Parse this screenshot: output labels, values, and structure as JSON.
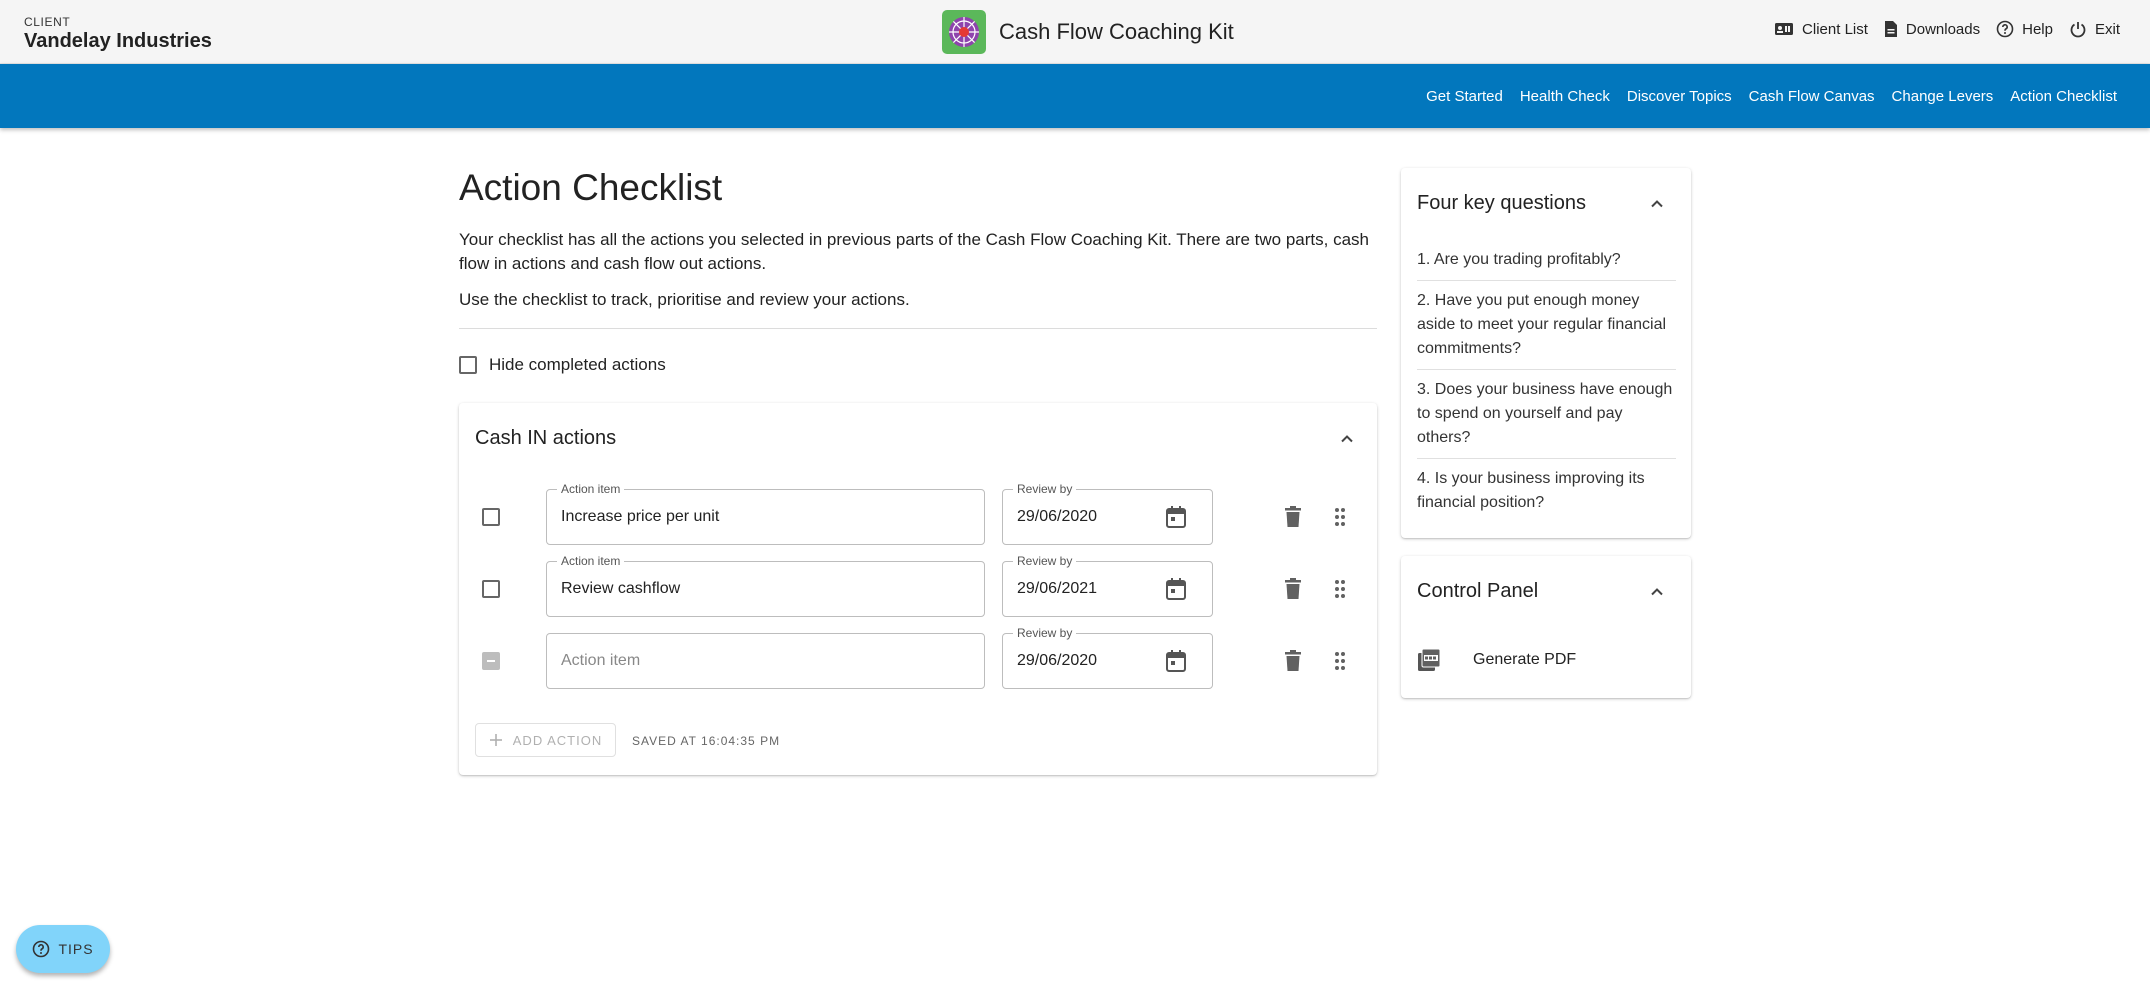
{
  "header": {
    "client_label": "CLIENT",
    "client_name": "Vandelay Industries",
    "app_title": "Cash Flow Coaching Kit",
    "links": [
      {
        "label": "Client List",
        "icon": "contact-card-icon"
      },
      {
        "label": "Downloads",
        "icon": "document-icon"
      },
      {
        "label": "Help",
        "icon": "help-circle-icon"
      },
      {
        "label": "Exit",
        "icon": "power-icon"
      }
    ]
  },
  "nav": {
    "items": [
      "Get Started",
      "Health Check",
      "Discover Topics",
      "Cash Flow Canvas",
      "Change Levers",
      "Action Checklist"
    ]
  },
  "main": {
    "title": "Action Checklist",
    "intro": "Your checklist has all the actions you selected in previous parts of the Cash Flow Coaching Kit. There are two parts, cash flow in actions and cash flow out actions.",
    "intro2": "Use the checklist to track, prioritise and review your actions.",
    "hide_completed_label": "Hide completed actions",
    "cash_in": {
      "title": "Cash IN actions",
      "action_label": "Action item",
      "review_label": "Review by",
      "rows": [
        {
          "action": "Increase price per unit",
          "review": "29/06/2020",
          "checked": false,
          "disabled": false
        },
        {
          "action": "Review cashflow",
          "review": "29/06/2021",
          "checked": false,
          "disabled": false
        },
        {
          "action": "",
          "action_placeholder": "Action item",
          "review": "29/06/2020",
          "checked": false,
          "disabled": true
        }
      ],
      "add_action_label": "ADD ACTION",
      "saved_text": "SAVED AT 16:04:35 PM"
    }
  },
  "sidebar": {
    "questions_title": "Four key questions",
    "questions": [
      "1. Are you trading profitably?",
      "2. Have you put enough money aside to meet your regular financial commitments?",
      "3. Does your business have enough to spend on yourself and pay others?",
      "4. Is your business improving its financial position?"
    ],
    "control_title": "Control Panel",
    "generate_pdf_label": "Generate PDF"
  },
  "tips_label": "TIPS",
  "colors": {
    "nav_blue": "#0277bd",
    "tips_blue": "#81d4fa",
    "logo_green": "#5bb85a",
    "logo_purple": "#8e44ad",
    "logo_red": "#e53935"
  }
}
